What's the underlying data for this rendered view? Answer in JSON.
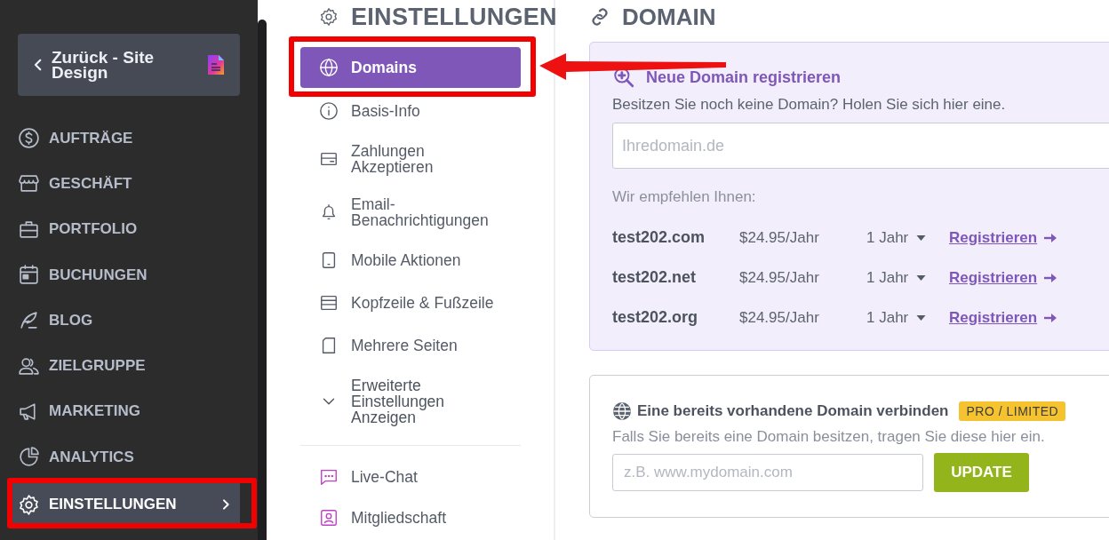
{
  "sidebar": {
    "back_button": {
      "label": "Zurück - Site Design"
    },
    "items": [
      {
        "label": "AUFTRÄGE",
        "selected": false
      },
      {
        "label": "GESCHÄFT",
        "selected": false
      },
      {
        "label": "PORTFOLIO",
        "selected": false
      },
      {
        "label": "BUCHUNGEN",
        "selected": false
      },
      {
        "label": "BLOG",
        "selected": false
      },
      {
        "label": "ZIELGRUPPE",
        "selected": false
      },
      {
        "label": "MARKETING",
        "selected": false
      },
      {
        "label": "ANALYTICS",
        "selected": false
      },
      {
        "label": "EINSTELLUNGEN",
        "selected": true
      }
    ]
  },
  "settings_nav": {
    "title": "EINSTELLUNGEN",
    "items": [
      {
        "label": "Domains",
        "selected": true
      },
      {
        "label": "Basis-Info",
        "selected": false
      },
      {
        "label": "Zahlungen Akzeptieren",
        "selected": false
      },
      {
        "label": "Email-Benachrichtigungen",
        "selected": false
      },
      {
        "label": "Mobile Aktionen",
        "selected": false
      },
      {
        "label": "Kopfzeile & Fußzeile",
        "selected": false
      },
      {
        "label": "Mehrere Seiten",
        "selected": false
      },
      {
        "label": "Erweiterte Einstellungen Anzeigen",
        "selected": false,
        "kind": "toggle",
        "expanded": false
      }
    ],
    "extra_items": [
      {
        "label": "Live-Chat",
        "selected": false
      },
      {
        "label": "Mitgliedschaft",
        "selected": false
      }
    ]
  },
  "domain": {
    "title": "DOMAIN",
    "register": {
      "title": "Neue Domain registrieren",
      "text": "Besitzen Sie noch keine Domain? Holen Sie sich hier eine.",
      "placeholder": "Ihredomain.de",
      "recommend_label": "Wir empfehlen Ihnen:",
      "suggestions": [
        {
          "domain": "test202.com",
          "price": "$24.95/Jahr",
          "term": "1 Jahr",
          "action": "Registrieren"
        },
        {
          "domain": "test202.net",
          "price": "$24.95/Jahr",
          "term": "1 Jahr",
          "action": "Registrieren"
        },
        {
          "domain": "test202.org",
          "price": "$24.95/Jahr",
          "term": "1 Jahr",
          "action": "Registrieren"
        }
      ]
    },
    "connect": {
      "title": "Eine bereits vorhandene Domain verbinden",
      "badge": "PRO / LIMITED",
      "text": "Falls Sie bereits eine Domain besitzen, tragen Sie diese hier ein.",
      "placeholder": "z.B. www.mydomain.com",
      "button": "UPDATE"
    }
  }
}
